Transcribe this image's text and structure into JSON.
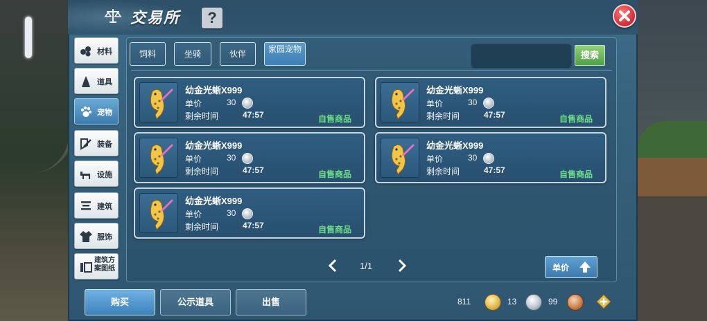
{
  "window": {
    "title": "交易所",
    "help_label": "?"
  },
  "sidebar": {
    "items": [
      {
        "label": "材料",
        "icon": "materials-icon"
      },
      {
        "label": "道具",
        "icon": "props-icon"
      },
      {
        "label": "宠物",
        "icon": "paw-icon",
        "active": true
      },
      {
        "label": "装备",
        "icon": "equipment-icon"
      },
      {
        "label": "设施",
        "icon": "facility-icon"
      },
      {
        "label": "建筑",
        "icon": "building-icon"
      },
      {
        "label": "服饰",
        "icon": "clothing-icon"
      },
      {
        "label": "建筑方案图纸",
        "icon": "blueprint-icon"
      }
    ]
  },
  "tabs": [
    {
      "label": "饲料"
    },
    {
      "label": "坐骑"
    },
    {
      "label": "伙伴"
    },
    {
      "label": "家园宠物",
      "active": true
    }
  ],
  "search": {
    "button_label": "搜索",
    "placeholder": ""
  },
  "listings": [
    {
      "name": "幼金光蜥X999",
      "price_label": "单价",
      "price": "30",
      "time_label": "剩余时间",
      "time": "47:57",
      "tag": "自售商品"
    },
    {
      "name": "幼金光蜥X999",
      "price_label": "单价",
      "price": "30",
      "time_label": "剩余时间",
      "time": "47:57",
      "tag": "自售商品"
    },
    {
      "name": "幼金光蜥X999",
      "price_label": "单价",
      "price": "30",
      "time_label": "剩余时间",
      "time": "47:57",
      "tag": "自售商品"
    },
    {
      "name": "幼金光蜥X999",
      "price_label": "单价",
      "price": "30",
      "time_label": "剩余时间",
      "time": "47:57",
      "tag": "自售商品"
    },
    {
      "name": "幼金光蜥X999",
      "price_label": "单价",
      "price": "30",
      "time_label": "剩余时间",
      "time": "47:57",
      "tag": "自售商品"
    }
  ],
  "pager": {
    "text": "1/1"
  },
  "sort": {
    "label": "单价"
  },
  "bottom": {
    "buy_label": "购买",
    "public_label": "公示道具",
    "sell_label": "出售"
  },
  "currency": {
    "gold": "811",
    "silver": "13",
    "copper": "99"
  },
  "colors": {
    "accent": "#3e7cb0",
    "self_tag": "#6fe08a",
    "search_btn": "#4fa24a",
    "close": "#d02a35"
  }
}
